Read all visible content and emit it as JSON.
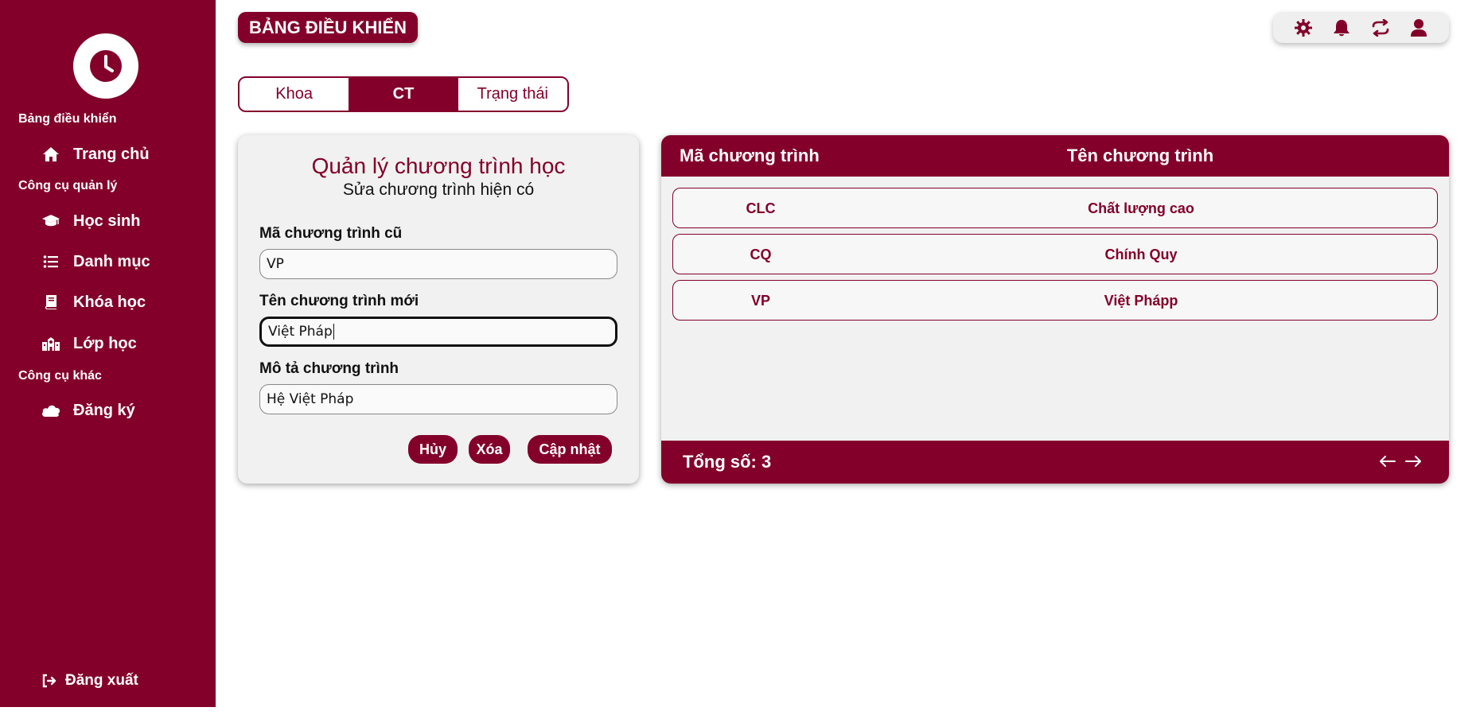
{
  "sidebar": {
    "section_dashboard": "Bảng điều khiển",
    "section_tools": "Công cụ quản lý",
    "section_other": "Công cụ khác",
    "items": [
      {
        "label": "Trang chủ",
        "icon": "home-icon"
      },
      {
        "label": "Học sinh",
        "icon": "graduation-cap-icon"
      },
      {
        "label": "Danh mục",
        "icon": "list-icon"
      },
      {
        "label": "Khóa học",
        "icon": "book-icon"
      },
      {
        "label": "Lớp học",
        "icon": "school-icon"
      },
      {
        "label": "Đăng ký",
        "icon": "cloud-icon"
      }
    ],
    "logout_label": "Đăng xuất"
  },
  "header": {
    "title": "BẢNG ĐIỀU KHIỂN",
    "toolbar_icons": [
      "gear-icon",
      "bell-icon",
      "refresh-icon",
      "user-icon"
    ]
  },
  "tabs": [
    {
      "label": "Khoa",
      "active": false
    },
    {
      "label": "CT",
      "active": true
    },
    {
      "label": "Trạng thái",
      "active": false
    }
  ],
  "form": {
    "title": "Quản lý chương trình học",
    "subtitle": "Sửa chương trình hiện có",
    "old_code_label": "Mã chương trình cũ",
    "old_code_value": "VP",
    "new_name_label": "Tên chương trình mới",
    "new_name_value": "Việt Pháp",
    "description_label": "Mô tả chương trình",
    "description_value": "Hệ Việt Pháp",
    "cancel_label": "Hủy",
    "delete_label": "Xóa",
    "update_label": "Cập nhật"
  },
  "table": {
    "columns": [
      "Mã chương trình",
      "Tên chương trình"
    ],
    "rows": [
      {
        "code": "CLC",
        "name": "Chất lượng cao"
      },
      {
        "code": "CQ",
        "name": "Chính Quy"
      },
      {
        "code": "VP",
        "name": "Việt Phápp"
      }
    ],
    "total_label": "Tổng số: 3"
  },
  "colors": {
    "brand": "#83002a",
    "card_bg": "#f1f1f1"
  }
}
